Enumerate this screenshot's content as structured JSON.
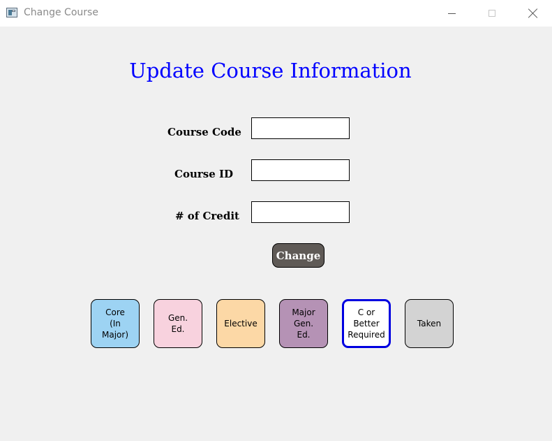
{
  "window": {
    "title": "Change Course"
  },
  "form": {
    "heading": "Update Course Information",
    "course_code_label": "Course Code",
    "course_code_value": "",
    "course_id_label": "Course ID",
    "course_id_value": "",
    "credit_label": "# of Credit",
    "credit_value": "",
    "change_button": "Change"
  },
  "legend": {
    "core": {
      "label": "Core\n(In\nMajor)",
      "color": "#9dd3f3"
    },
    "gen_ed": {
      "label": "Gen.\nEd.",
      "color": "#f8d2de"
    },
    "elective": {
      "label": "Elective",
      "color": "#fcd8a6"
    },
    "major_gen_ed": {
      "label": "Major\nGen.\nEd.",
      "color": "#b592b5"
    },
    "c_or_better": {
      "label": "C or\nBetter\nRequired",
      "color": "#0000e0"
    },
    "taken": {
      "label": "Taken",
      "color": "#d3d3d3"
    }
  }
}
